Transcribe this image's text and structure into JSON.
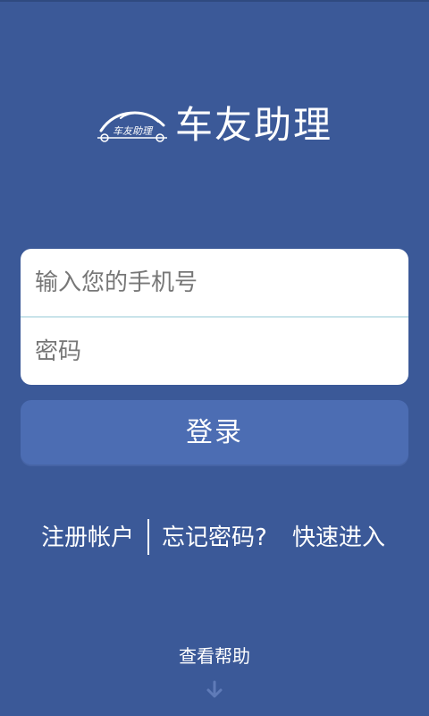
{
  "app": {
    "title": "车友助理",
    "logo_text": "车友助理"
  },
  "login": {
    "phone_placeholder": "输入您的手机号",
    "password_placeholder": "密码",
    "submit_label": "登录"
  },
  "links": {
    "register": "注册帐户",
    "forgot": "忘记密码?",
    "quick_entry": "快速进入"
  },
  "help": {
    "label": "查看帮助",
    "icon": "arrow-down-icon"
  },
  "colors": {
    "background": "#3b5998",
    "button": "#4c6db3",
    "card": "#ffffff",
    "divider": "#c9e4ea"
  }
}
